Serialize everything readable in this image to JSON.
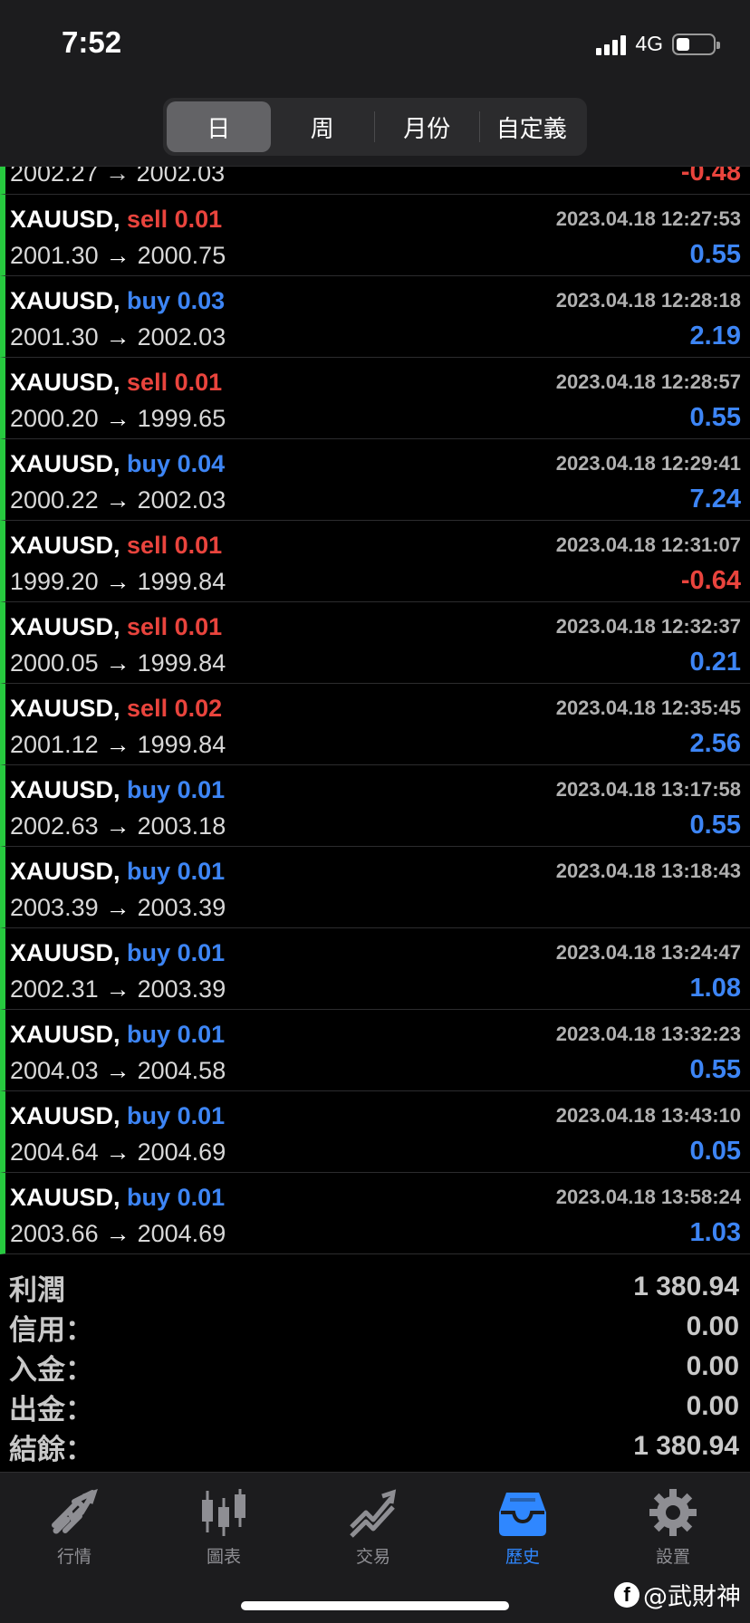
{
  "status_bar": {
    "time": "7:52",
    "network": "4G"
  },
  "period_tabs": [
    {
      "label": "日",
      "active": true
    },
    {
      "label": "周",
      "active": false
    },
    {
      "label": "月份",
      "active": false
    },
    {
      "label": "自定義",
      "active": false
    }
  ],
  "partial_row": {
    "prices": "2002.27 → 2002.03",
    "profit": "-0.48"
  },
  "trades": [
    {
      "symbol": "XAUUSD",
      "type": "sell",
      "volume": "0.01",
      "open": "2001.30",
      "close": "2000.75",
      "time": "2023.04.18 12:27:53",
      "profit": "0.55"
    },
    {
      "symbol": "XAUUSD",
      "type": "buy",
      "volume": "0.03",
      "open": "2001.30",
      "close": "2002.03",
      "time": "2023.04.18 12:28:18",
      "profit": "2.19"
    },
    {
      "symbol": "XAUUSD",
      "type": "sell",
      "volume": "0.01",
      "open": "2000.20",
      "close": "1999.65",
      "time": "2023.04.18 12:28:57",
      "profit": "0.55"
    },
    {
      "symbol": "XAUUSD",
      "type": "buy",
      "volume": "0.04",
      "open": "2000.22",
      "close": "2002.03",
      "time": "2023.04.18 12:29:41",
      "profit": "7.24"
    },
    {
      "symbol": "XAUUSD",
      "type": "sell",
      "volume": "0.01",
      "open": "1999.20",
      "close": "1999.84",
      "time": "2023.04.18 12:31:07",
      "profit": "-0.64"
    },
    {
      "symbol": "XAUUSD",
      "type": "sell",
      "volume": "0.01",
      "open": "2000.05",
      "close": "1999.84",
      "time": "2023.04.18 12:32:37",
      "profit": "0.21"
    },
    {
      "symbol": "XAUUSD",
      "type": "sell",
      "volume": "0.02",
      "open": "2001.12",
      "close": "1999.84",
      "time": "2023.04.18 12:35:45",
      "profit": "2.56"
    },
    {
      "symbol": "XAUUSD",
      "type": "buy",
      "volume": "0.01",
      "open": "2002.63",
      "close": "2003.18",
      "time": "2023.04.18 13:17:58",
      "profit": "0.55"
    },
    {
      "symbol": "XAUUSD",
      "type": "buy",
      "volume": "0.01",
      "open": "2003.39",
      "close": "2003.39",
      "time": "2023.04.18 13:18:43",
      "profit": ""
    },
    {
      "symbol": "XAUUSD",
      "type": "buy",
      "volume": "0.01",
      "open": "2002.31",
      "close": "2003.39",
      "time": "2023.04.18 13:24:47",
      "profit": "1.08"
    },
    {
      "symbol": "XAUUSD",
      "type": "buy",
      "volume": "0.01",
      "open": "2004.03",
      "close": "2004.58",
      "time": "2023.04.18 13:32:23",
      "profit": "0.55"
    },
    {
      "symbol": "XAUUSD",
      "type": "buy",
      "volume": "0.01",
      "open": "2004.64",
      "close": "2004.69",
      "time": "2023.04.18 13:43:10",
      "profit": "0.05"
    },
    {
      "symbol": "XAUUSD",
      "type": "buy",
      "volume": "0.01",
      "open": "2003.66",
      "close": "2004.69",
      "time": "2023.04.18 13:58:24",
      "profit": "1.03"
    }
  ],
  "summary": [
    {
      "label": "利潤",
      "value": "1 380.94"
    },
    {
      "label": "信用：",
      "value": "0.00"
    },
    {
      "label": "入金：",
      "value": "0.00"
    },
    {
      "label": "出金：",
      "value": "0.00"
    },
    {
      "label": "結餘：",
      "value": "1 380.94"
    }
  ],
  "tabbar": [
    {
      "label": "行情",
      "icon": "quotes-icon",
      "active": false
    },
    {
      "label": "圖表",
      "icon": "chart-icon",
      "active": false
    },
    {
      "label": "交易",
      "icon": "trade-icon",
      "active": false
    },
    {
      "label": "歷史",
      "icon": "history-icon",
      "active": true
    },
    {
      "label": "設置",
      "icon": "settings-icon",
      "active": false
    }
  ],
  "watermark": {
    "text": "@武財神"
  },
  "colors": {
    "buy": "#3d85f5",
    "sell": "#e9443d",
    "accent": "#2f87ff",
    "row_marker": "#27c93f"
  }
}
